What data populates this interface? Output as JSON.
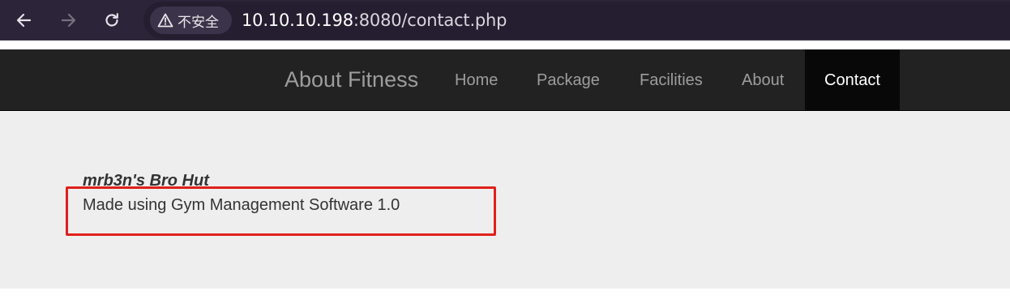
{
  "browser": {
    "security_label": "不安全",
    "url_host": "10.10.10.198",
    "url_rest": ":8080/contact.php"
  },
  "navbar": {
    "brand": "About Fitness",
    "links": [
      {
        "label": "Home"
      },
      {
        "label": "Package"
      },
      {
        "label": "Facilities"
      },
      {
        "label": "About"
      },
      {
        "label": "Contact",
        "active": true
      }
    ]
  },
  "content": {
    "site_name": "mrb3n's Bro Hut",
    "made_using": "Made using Gym Management Software 1.0"
  },
  "icons": {
    "back": "arrow-left-icon",
    "forward": "arrow-right-icon",
    "reload": "reload-icon",
    "warning": "warning-triangle-icon"
  },
  "colors": {
    "browser_bar": "#2c2438",
    "navbar": "#222222",
    "nav_active": "#080808",
    "content_bg": "#eeeeee",
    "highlight_border": "#e0201b"
  }
}
